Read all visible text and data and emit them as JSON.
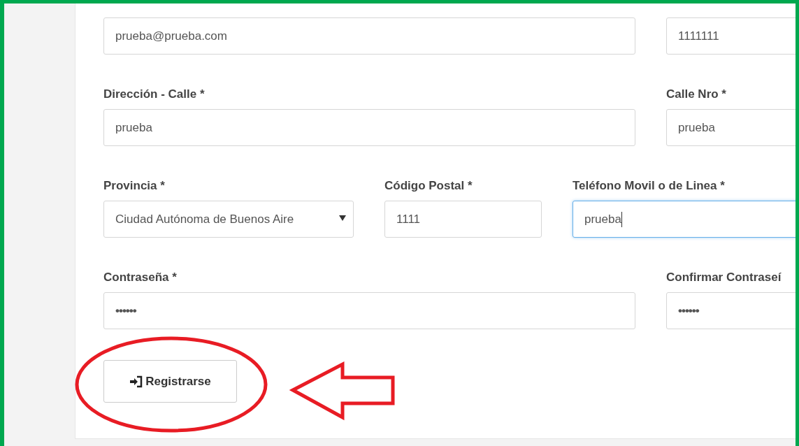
{
  "rows": [
    [
      {
        "kind": "text",
        "value": "prueba@prueba.com",
        "focused": false
      },
      {
        "kind": "text",
        "value": "1111111",
        "focused": false
      }
    ],
    [
      {
        "kind": "text",
        "label": "Dirección - Calle *",
        "value": "prueba",
        "focused": false
      },
      {
        "kind": "text",
        "label": "Calle Nro *",
        "value": "prueba",
        "focused": false
      }
    ],
    [
      {
        "kind": "select",
        "label": "Provincia *",
        "value": "Ciudad Autónoma de Buenos Aire",
        "focused": false
      },
      {
        "kind": "text",
        "label": "Código Postal *",
        "value": "1111",
        "focused": false
      },
      {
        "kind": "text",
        "label": "Teléfono Movil o de Linea *",
        "value": "prueba",
        "focused": true
      }
    ],
    [
      {
        "kind": "password",
        "label": "Contraseña *",
        "value": "••••••",
        "focused": false
      },
      {
        "kind": "password",
        "label": "Confirmar Contraseí",
        "value": "••••••",
        "focused": false
      }
    ]
  ],
  "submit": {
    "label": "Registrarse"
  },
  "annotations": [
    {
      "kind": "ellipse"
    },
    {
      "kind": "arrow"
    }
  ]
}
